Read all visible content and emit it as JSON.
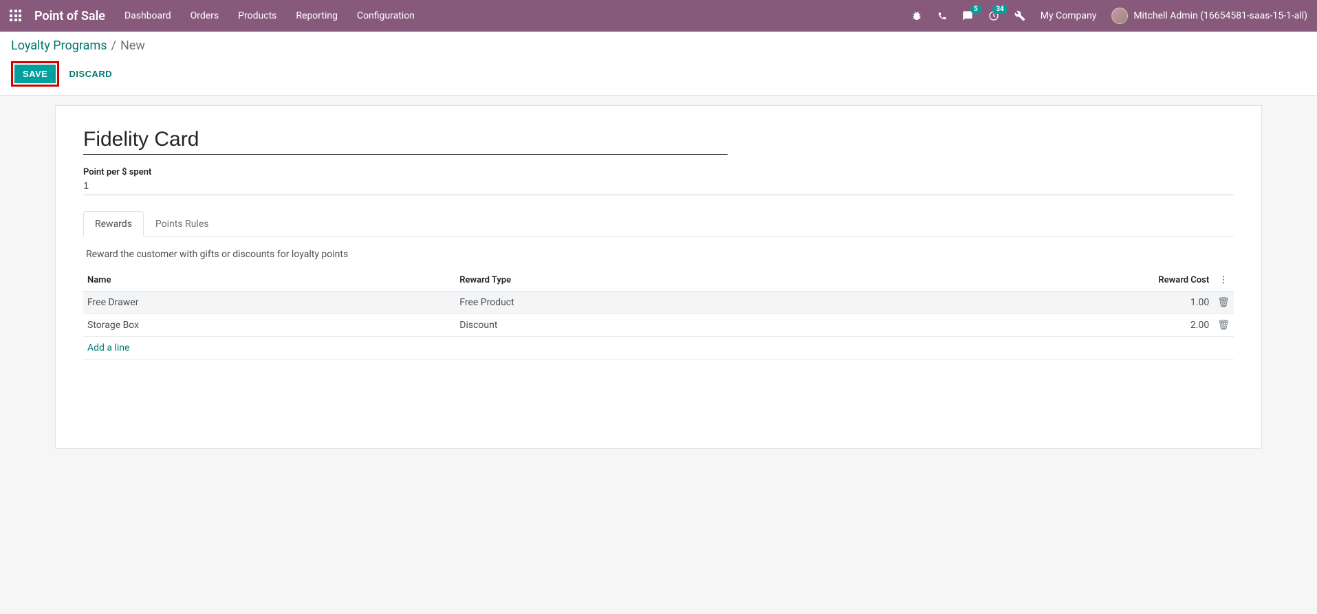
{
  "navbar": {
    "brand": "Point of Sale",
    "menu": [
      "Dashboard",
      "Orders",
      "Products",
      "Reporting",
      "Configuration"
    ],
    "messages_badge": "5",
    "activities_badge": "34",
    "company": "My Company",
    "user": "Mitchell Admin (16654581-saas-15-1-all)"
  },
  "breadcrumb": {
    "parent": "Loyalty Programs",
    "current": "New"
  },
  "actions": {
    "save": "SAVE",
    "discard": "DISCARD"
  },
  "form": {
    "title": "Fidelity Card",
    "point_label": "Point per $ spent",
    "point_value": "1"
  },
  "tabs": {
    "rewards": "Rewards",
    "points_rules": "Points Rules"
  },
  "rewards_tab": {
    "description": "Reward the customer with gifts or discounts for loyalty points",
    "columns": {
      "name": "Name",
      "type": "Reward Type",
      "cost": "Reward Cost"
    },
    "rows": [
      {
        "name": "Free Drawer",
        "type": "Free Product",
        "cost": "1.00"
      },
      {
        "name": "Storage Box",
        "type": "Discount",
        "cost": "2.00"
      }
    ],
    "add_line": "Add a line"
  }
}
